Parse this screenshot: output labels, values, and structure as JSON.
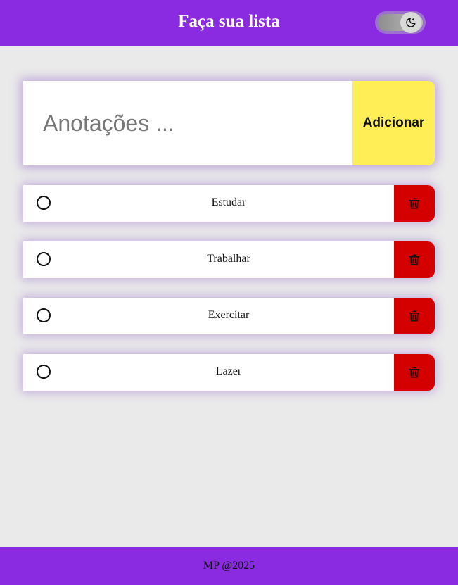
{
  "header": {
    "title": "Faça sua lista",
    "theme_toggle": {
      "icon": "moon-icon",
      "state": "dark-mode-off"
    }
  },
  "input_card": {
    "placeholder": "Anotações ...",
    "value": "",
    "add_label": "Adicionar"
  },
  "tasks": [
    {
      "label": "Estudar",
      "done": false,
      "delete_icon": "trash-icon"
    },
    {
      "label": "Trabalhar",
      "done": false,
      "delete_icon": "trash-icon"
    },
    {
      "label": "Exercitar",
      "done": false,
      "delete_icon": "trash-icon"
    },
    {
      "label": "Lazer",
      "done": false,
      "delete_icon": "trash-icon"
    }
  ],
  "footer": {
    "text": "MP @2025"
  },
  "colors": {
    "primary": "#8a2be2",
    "background": "#eaeaea",
    "add_button": "#ffee55",
    "delete_button": "#d40000"
  }
}
